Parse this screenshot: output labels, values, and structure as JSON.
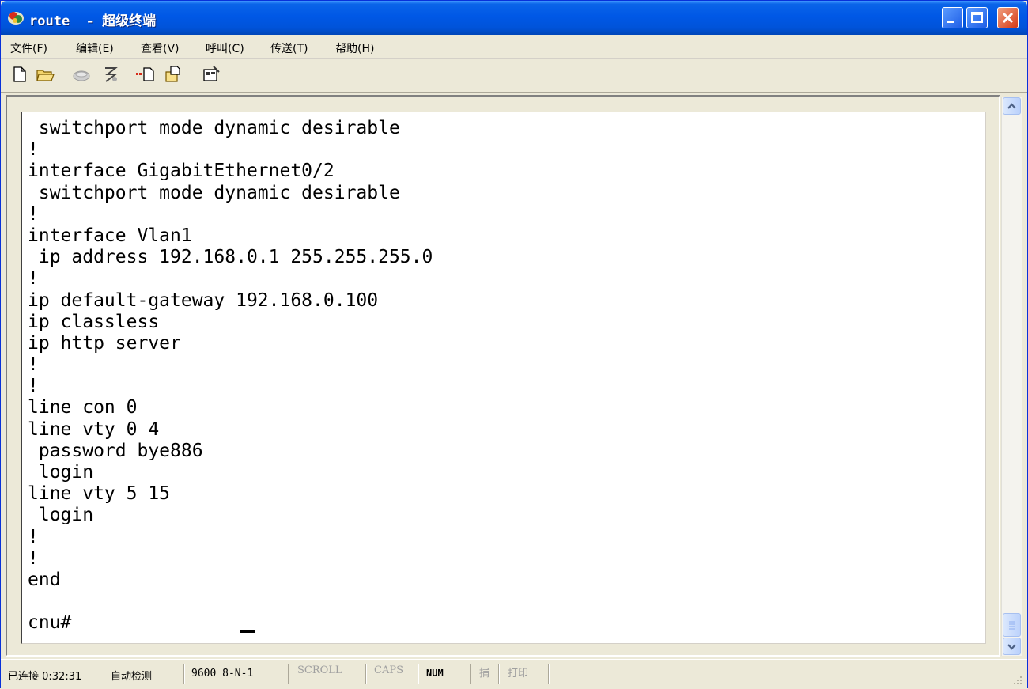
{
  "window": {
    "title": "route  - 超级终端"
  },
  "menu": {
    "items": [
      "文件(F)",
      "编辑(E)",
      "查看(V)",
      "呼叫(C)",
      "传送(T)",
      "帮助(H)"
    ]
  },
  "toolbar": {
    "icons": [
      "new-icon",
      "open-icon",
      "disconnect-icon",
      "dial-icon",
      "send-icon",
      "receive-icon",
      "properties-icon"
    ]
  },
  "terminal": {
    "lines": [
      " switchport mode dynamic desirable",
      "!",
      "interface GigabitEthernet0/2",
      " switchport mode dynamic desirable",
      "!",
      "interface Vlan1",
      " ip address 192.168.0.1 255.255.255.0",
      "!",
      "ip default-gateway 192.168.0.100",
      "ip classless",
      "ip http server",
      "!",
      "!",
      "line con 0",
      "line vty 0 4",
      " password bye886",
      " login",
      "line vty 5 15",
      " login",
      "!",
      "!",
      "end",
      "",
      "cnu#"
    ]
  },
  "status": {
    "connection": "已连接 0:32:31",
    "detect": "自动检测",
    "params": "9600 8-N-1",
    "scroll": "SCROLL",
    "caps": "CAPS",
    "num": "NUM",
    "capture": "捕",
    "print": "打印"
  },
  "colors": {
    "titlebar": "#0058e6",
    "close_button": "#d63a17",
    "chrome": "#ece9d8"
  }
}
